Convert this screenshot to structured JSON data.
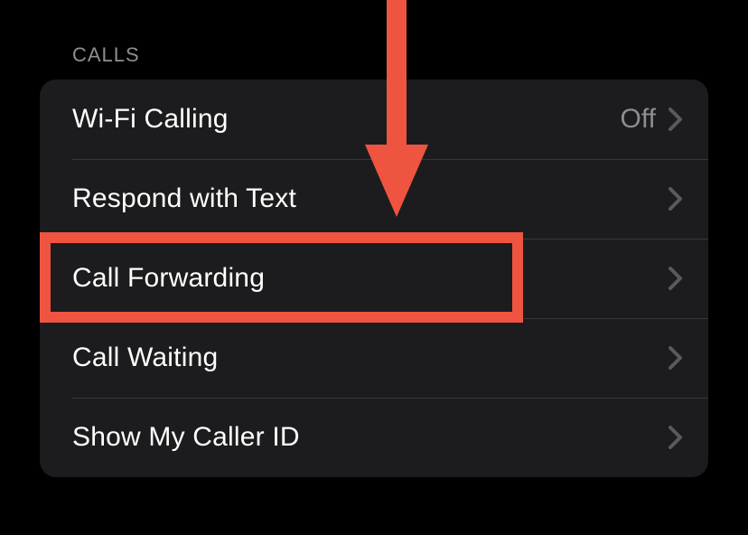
{
  "section": {
    "header": "CALLS"
  },
  "rows": {
    "wifi_calling": {
      "label": "Wi-Fi Calling",
      "detail": "Off"
    },
    "respond_with_text": {
      "label": "Respond with Text"
    },
    "call_forwarding": {
      "label": "Call Forwarding"
    },
    "call_waiting": {
      "label": "Call Waiting"
    },
    "show_my_caller_id": {
      "label": "Show My Caller ID"
    }
  },
  "annotation": {
    "arrow_color": "#ef5440",
    "highlight_color": "#ef5440"
  }
}
